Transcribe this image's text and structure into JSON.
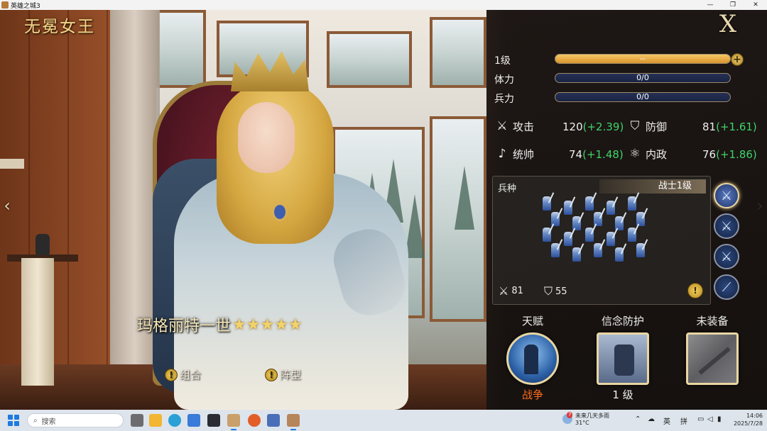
{
  "window": {
    "title": "英雄之城3",
    "controls": [
      "minimize-icon",
      "restore-icon",
      "close-icon"
    ]
  },
  "hero": {
    "title": "无冕女王",
    "name": "玛格丽特一世",
    "stars": 5,
    "star_glyph": "★",
    "buttons": {
      "combo_label": "组合",
      "formation_label": "阵型"
    },
    "alert_glyph": "!"
  },
  "panel": {
    "close_glyph": "X",
    "level": {
      "label": "1级",
      "value_text": "--",
      "progress": 1.0
    },
    "stamina": {
      "label": "体力",
      "value_text": "0/0",
      "progress": 0.0
    },
    "troops": {
      "label": "兵力",
      "value_text": "0/0",
      "progress": 0.0
    },
    "plus_glyph": "+",
    "attributes": {
      "attack": {
        "label": "攻击",
        "value": "120",
        "bonus": "(+2.39)",
        "icon": "crossed-swords-icon"
      },
      "defense": {
        "label": "防御",
        "value": "81",
        "bonus": "(+1.61)",
        "icon": "shield-icon"
      },
      "command": {
        "label": "统帅",
        "value": "74",
        "bonus": "(+1.48)",
        "icon": "horn-icon"
      },
      "politics": {
        "label": "内政",
        "value": "76",
        "bonus": "(+1.86)",
        "icon": "atom-icon"
      }
    },
    "troop_box": {
      "header": "兵种",
      "unit_tag": "战士1级",
      "attack_value": "81",
      "defense_value": "55",
      "soldier_count": 20
    },
    "troop_types": [
      {
        "name": "warrior-type-icon",
        "glyph": "✕",
        "active": true
      },
      {
        "name": "archer-type-icon",
        "glyph": "✕",
        "active": false
      },
      {
        "name": "cavalry-type-icon",
        "glyph": "✕",
        "active": false
      },
      {
        "name": "spear-type-icon",
        "glyph": "⟋",
        "active": false
      }
    ],
    "slots": {
      "talent": {
        "label": "天赋",
        "caption": "战争",
        "caption_color": "#ff6a1a"
      },
      "faith": {
        "label": "信念防护",
        "caption": "1 级",
        "caption_color": "#f0f0f0"
      },
      "equip": {
        "label": "未装备"
      }
    }
  },
  "taskbar": {
    "search_placeholder": "搜索",
    "weather": {
      "badge": "7",
      "line1": "未来几天多雨",
      "line2": "31°C"
    },
    "tray": {
      "ime_lang": "英",
      "ime_mode": "拼"
    },
    "clock": {
      "time": "14:06",
      "date": "2025/7/28"
    },
    "apps": [
      "file-manager-icon",
      "folder-icon",
      "edge-browser-icon",
      "store-icon",
      "terminal-icon",
      "game-app-icon",
      "firefox-icon",
      "tool-app-icon",
      "game-app-icon-2"
    ]
  },
  "colors": {
    "bonus_green": "#3fd36a",
    "gold_bar": "#f6c767",
    "bar_bg": "#243055"
  }
}
